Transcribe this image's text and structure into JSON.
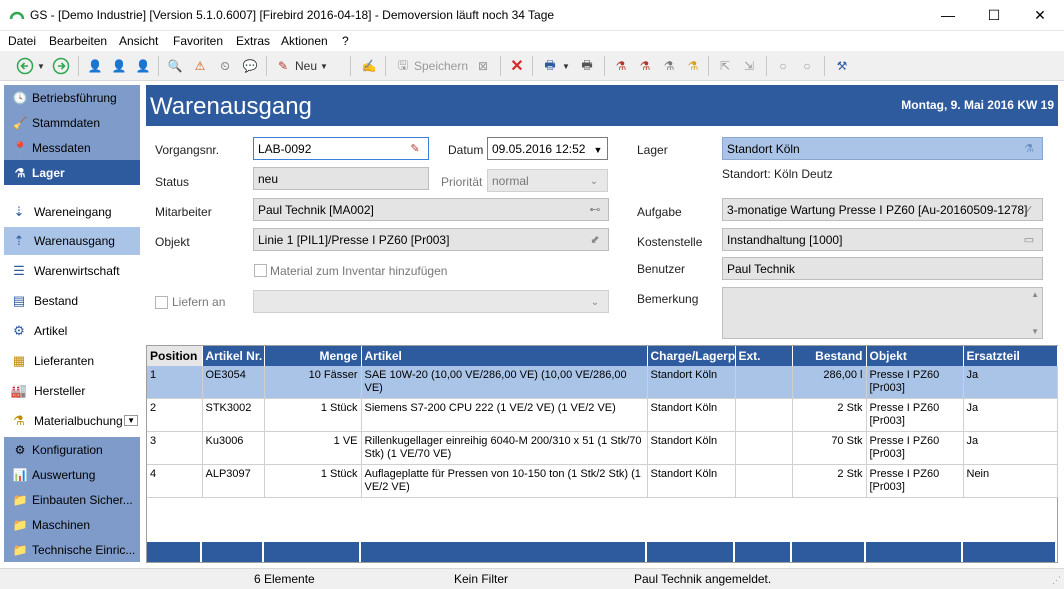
{
  "window": {
    "title": "GS - [Demo Industrie]  [Version  5.1.0.6007]  [Firebird 2016-04-18] - Demoversion läuft noch 34 Tage",
    "minimize_glyph": "—",
    "maximize_glyph": "☐",
    "close_glyph": "✕"
  },
  "menu": [
    "Datei",
    "Bearbeiten",
    "Ansicht",
    "Favoriten",
    "Extras",
    "Aktionen",
    "?"
  ],
  "toolbar": {
    "new_label": "Neu",
    "save_label": "Speichern"
  },
  "sidebar": {
    "groups_top": [
      {
        "label": "Betriebsführung",
        "icon": "clock-icon"
      },
      {
        "label": "Stammdaten",
        "icon": "broom-icon"
      },
      {
        "label": "Messdaten",
        "icon": "probe-icon"
      },
      {
        "label": "Lager",
        "icon": "lager-icon",
        "active": true
      }
    ],
    "sub_items": [
      {
        "label": "Wareneingang",
        "icon": "inbound-icon"
      },
      {
        "label": "Warenausgang",
        "icon": "outbound-icon",
        "active": true
      },
      {
        "label": "Warenwirtschaft",
        "icon": "warehouse-icon"
      },
      {
        "label": "Bestand",
        "icon": "stock-icon"
      },
      {
        "label": "Artikel",
        "icon": "article-icon"
      },
      {
        "label": "Lieferanten",
        "icon": "supplier-icon"
      },
      {
        "label": "Hersteller",
        "icon": "manufacturer-icon"
      },
      {
        "label": "Materialbuchung",
        "icon": "booking-icon"
      }
    ],
    "groups_bottom": [
      {
        "label": "Konfiguration",
        "icon": "gear-icon"
      },
      {
        "label": "Auswertung",
        "icon": "chart-icon"
      },
      {
        "label": "Einbauten Sicher...",
        "icon": "folder-icon"
      },
      {
        "label": "Maschinen",
        "icon": "folder-icon"
      },
      {
        "label": "Technische Einric...",
        "icon": "folder-icon"
      }
    ]
  },
  "header": {
    "title": "Warenausgang",
    "date": "Montag, 9. Mai 2016  KW 19"
  },
  "form": {
    "vorgangsnr_label": "Vorgangsnr.",
    "vorgangsnr_value": "LAB-0092",
    "datum_label": "Datum",
    "datum_value": "09.05.2016 12:52",
    "status_label": "Status",
    "status_value": "neu",
    "prioritaet_label": "Priorität",
    "prioritaet_value": "normal",
    "mitarbeiter_label": "Mitarbeiter",
    "mitarbeiter_value": "Paul Technik [MA002]",
    "objekt_label": "Objekt",
    "objekt_value": "Linie 1 [PIL1]/Presse I PZ60 [Pr003]",
    "material_label": "Material zum Inventar hinzufügen",
    "liefern_label": "Liefern an",
    "liefern_value": "",
    "lager_label": "Lager",
    "lager_value": "Standort Köln",
    "lager_info": "Standort: Köln Deutz",
    "aufgabe_label": "Aufgabe",
    "aufgabe_value": "3-monatige Wartung Presse I PZ60 [Au-20160509-1278]",
    "kostenstelle_label": "Kostenstelle",
    "kostenstelle_value": "Instandhaltung [1000]",
    "benutzer_label": "Benutzer",
    "benutzer_value": "Paul Technik",
    "bemerkung_label": "Bemerkung",
    "bemerkung_value": ""
  },
  "grid": {
    "columns": [
      "Position",
      "Artikel Nr.",
      "Menge",
      "Artikel",
      "Charge/Lagerpl",
      "Ext.",
      "Bestand",
      "Objekt",
      "Ersatzteil"
    ],
    "rows": [
      {
        "pos": "1",
        "artnr": "OE3054",
        "menge": "10 Fässer",
        "artikel": "SAE 10W-20 (10,00 VE/286,00 VE) (10,00 VE/286,00 VE)",
        "charge": "Standort Köln",
        "ext": "",
        "bestand": "286,00 l",
        "objekt": "Presse I PZ60 [Pr003]",
        "ersatz": "Ja"
      },
      {
        "pos": "2",
        "artnr": "STK3002",
        "menge": "1 Stück",
        "artikel": "Siemens S7-200 CPU 222 (1 VE/2 VE) (1 VE/2 VE)",
        "charge": "Standort Köln",
        "ext": "",
        "bestand": "2 Stk",
        "objekt": "Presse I PZ60 [Pr003]",
        "ersatz": "Ja"
      },
      {
        "pos": "3",
        "artnr": "Ku3006",
        "menge": "1 VE",
        "artikel": "Rillenkugellager einreihig 6040-M 200/310 x 51 (1 Stk/70 Stk) (1 VE/70 VE)",
        "charge": "Standort Köln",
        "ext": "",
        "bestand": "70 Stk",
        "objekt": "Presse I PZ60 [Pr003]",
        "ersatz": "Ja"
      },
      {
        "pos": "4",
        "artnr": "ALP3097",
        "menge": "1 Stück",
        "artikel": "Auflageplatte für Pressen von 10-150 ton (1 Stk/2 Stk) (1 VE/2 VE)",
        "charge": "Standort Köln",
        "ext": "",
        "bestand": "2 Stk",
        "objekt": "Presse I PZ60 [Pr003]",
        "ersatz": "Nein"
      }
    ]
  },
  "status": {
    "count": "6 Elemente",
    "filter": "Kein Filter",
    "user": "Paul Technik angemeldet."
  }
}
